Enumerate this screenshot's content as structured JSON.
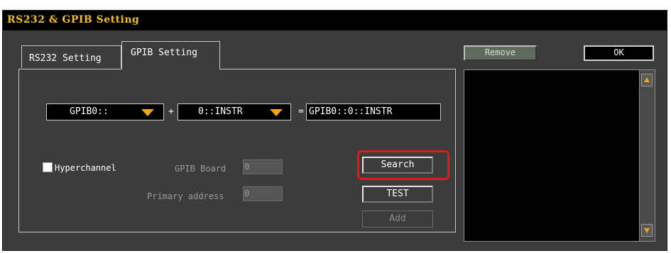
{
  "dialog": {
    "title": "RS232 & GPIB Setting"
  },
  "tabs": {
    "rs232": "RS232 Setting",
    "gpib": "GPIB Setting"
  },
  "gpib": {
    "board_select": "GPIB0::",
    "plus_label": "+",
    "address_select": "0::INSTR",
    "equals_label": "=",
    "resource_string": "GPIB0::0::INSTR",
    "hyperchannel_label": "Hyperchannel",
    "hyperchannel_checked": false,
    "gpib_board_label": "GPIB Board",
    "gpib_board_value": "0",
    "primary_address_label": "Primary address",
    "primary_address_value": "0"
  },
  "buttons": {
    "search": "Search",
    "test": "TEST",
    "add": "Add",
    "remove": "Remove",
    "ok": "OK"
  },
  "colors": {
    "title_text": "#f0c020",
    "accent_caret": "#f0a800",
    "highlight": "#d81f1f",
    "background": "#3c3c3c"
  },
  "icons": {
    "dropdown": "chevron-down-icon",
    "scroll_up": "scroll-up-arrow-icon",
    "scroll_down": "scroll-down-arrow-icon"
  }
}
